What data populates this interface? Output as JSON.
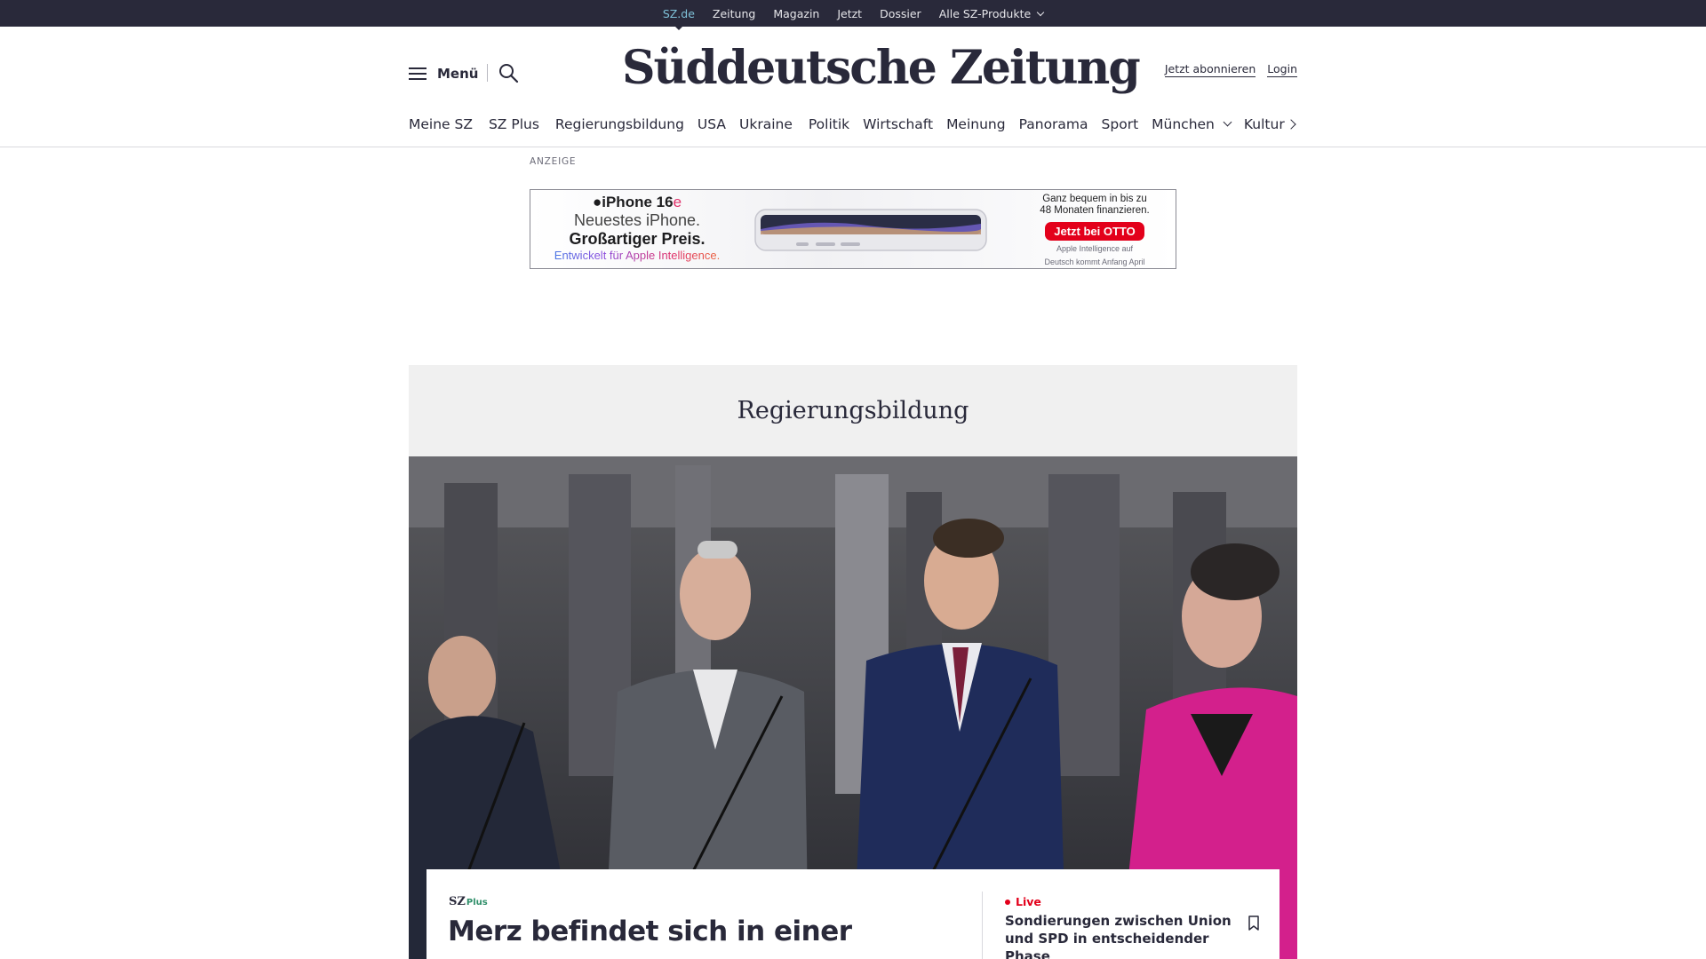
{
  "topbar": {
    "links": [
      "SZ.de",
      "Zeitung",
      "Magazin",
      "Jetzt",
      "Dossier"
    ],
    "products_label": "Alle SZ-Produkte"
  },
  "header": {
    "menu_label": "Menü",
    "logo_text": "Süddeutsche Zeitung",
    "subscribe_label": "Jetzt abonnieren",
    "login_label": "Login"
  },
  "section_nav": {
    "items": [
      "Meine SZ",
      "SZ Plus",
      "Regierungsbildung",
      "USA",
      "Ukraine",
      "Politik",
      "Wirtschaft",
      "Meinung",
      "Panorama",
      "Sport",
      "München",
      "Kultur"
    ]
  },
  "ad": {
    "label": "ANZEIGE",
    "product": "iPhone 16",
    "product_suffix": "e",
    "line1": "Neuestes iPhone.",
    "line2": "Großartiger Preis.",
    "line3": "Entwickelt für Apple Intelligence.",
    "finance_1": "Ganz bequem in bis zu",
    "finance_2": "48 Monaten finanzieren.",
    "cta": "Jetzt bei OTTO",
    "note_1": "Apple Intelligence auf",
    "note_2": "Deutsch kommt Anfang April"
  },
  "teaser": {
    "section_title": "Regierungsbildung",
    "badge_sz": "SZ",
    "badge_plus": "Plus",
    "headline": "Merz befindet sich in einer",
    "live_label": "Live",
    "live_title": "Sondierungen zwischen Union und SPD in entscheidender Phase"
  },
  "colors": {
    "topbar_bg": "#29293a",
    "active_link": "#7fc1d8",
    "live_red": "#e3001b",
    "sz_plus_green": "#2f8f6a",
    "section_header_bg": "#f0f0f0"
  }
}
